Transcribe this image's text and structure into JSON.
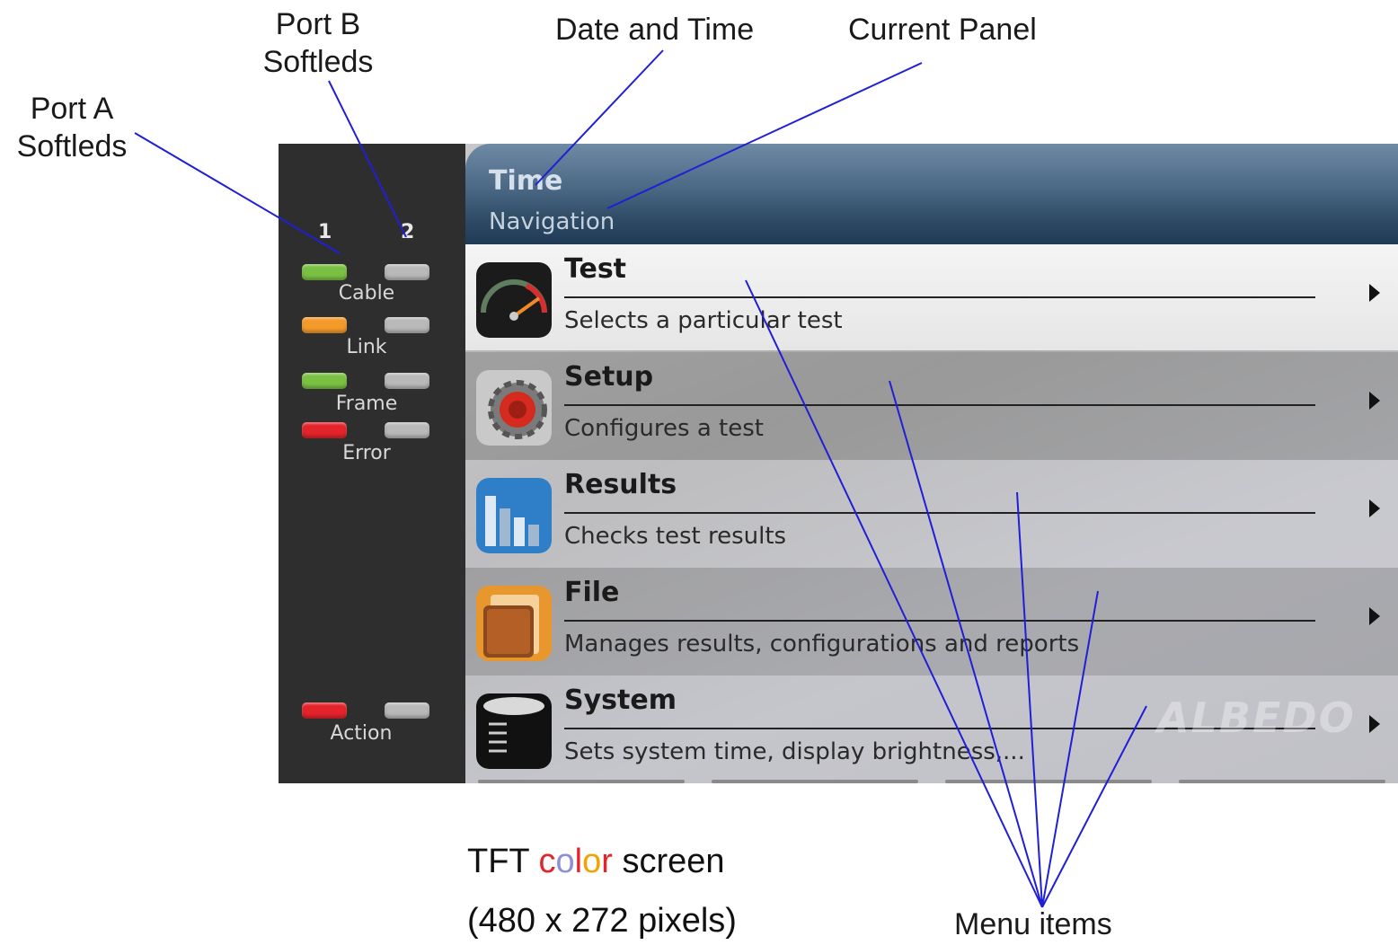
{
  "callouts": {
    "port_a": [
      "Port A",
      "Softleds"
    ],
    "port_b": [
      "Port B",
      "Softleds"
    ],
    "date_time": "Date and Time",
    "current_panel": "Current Panel",
    "menu_items": "Menu items"
  },
  "leds": {
    "port_numbers": [
      "1",
      "2"
    ],
    "rows": [
      {
        "label": "Cable",
        "port_a_color": "#7ac143",
        "port_b_color": "#b9b9b9"
      },
      {
        "label": "Link",
        "port_a_color": "#f39a2b",
        "port_b_color": "#b9b9b9"
      },
      {
        "label": "Frame",
        "port_a_color": "#7ac143",
        "port_b_color": "#b9b9b9"
      },
      {
        "label": "Error",
        "port_a_color": "#e3242b",
        "port_b_color": "#b9b9b9"
      },
      {
        "label": "Action",
        "port_a_color": "#e3242b",
        "port_b_color": "#b9b9b9"
      }
    ]
  },
  "header": {
    "time": "Time",
    "panel": "Navigation"
  },
  "menu": [
    {
      "title": "Test",
      "description": "Selects a particular test",
      "icon": "gauge-icon"
    },
    {
      "title": "Setup",
      "description": "Configures a test",
      "icon": "gear-icon"
    },
    {
      "title": "Results",
      "description": "Checks test results",
      "icon": "bar-chart-icon"
    },
    {
      "title": "File",
      "description": "Manages results, configurations and reports",
      "icon": "folder-icon"
    },
    {
      "title": "System",
      "description": "Sets system time, display brightness,...",
      "icon": "system-icon"
    }
  ],
  "watermark": "ALBEDO",
  "caption": {
    "line1_prefix": "TFT ",
    "line1_color_word": [
      "c",
      "o",
      "l",
      "o",
      "r"
    ],
    "line1_color_word_colors": [
      "#e3242b",
      "#8f8fd6",
      "#e3242b",
      "#f2a300",
      "#e3242b"
    ],
    "line1_suffix": " screen",
    "line2": "(480 x 272 pixels)"
  },
  "colors": {
    "annotation_line": "#1f1fd6",
    "header_blue": "#2f4b66",
    "panel_dark": "#2e2e2e"
  }
}
